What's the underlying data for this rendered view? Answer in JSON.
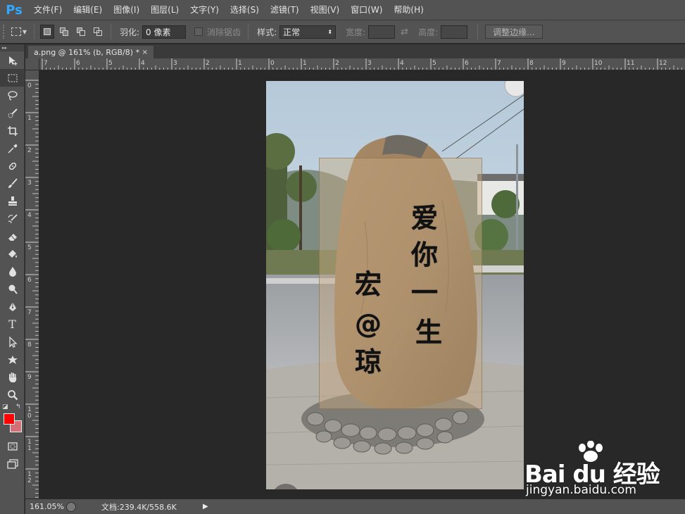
{
  "app": {
    "logo": "Ps",
    "menu": [
      "文件(F)",
      "编辑(E)",
      "图像(I)",
      "图层(L)",
      "文字(Y)",
      "选择(S)",
      "滤镜(T)",
      "视图(V)",
      "窗口(W)",
      "帮助(H)"
    ]
  },
  "options": {
    "feather_label": "羽化:",
    "feather_value": "0 像素",
    "antialias_label": "消除锯齿",
    "style_label": "样式:",
    "style_value": "正常",
    "width_label": "宽度:",
    "height_label": "高度:",
    "refine_edge_label": "调整边缘..."
  },
  "toolbar": {
    "tools": [
      "move-tool",
      "rectangular-marquee-tool",
      "lasso-tool",
      "quick-selection-tool",
      "crop-tool",
      "eyedropper-tool",
      "spot-healing-brush-tool",
      "brush-tool",
      "clone-stamp-tool",
      "history-brush-tool",
      "eraser-tool",
      "paint-bucket-tool",
      "blur-tool",
      "dodge-tool",
      "pen-tool",
      "type-tool",
      "path-selection-tool",
      "custom-shape-tool",
      "hand-tool",
      "zoom-tool"
    ],
    "foreground_color": "#ff0000",
    "background_color": "#d46f78"
  },
  "document": {
    "tab_label": "a.png @ 161% (b, RGB/8) *",
    "tab_close": "×"
  },
  "rulers": {
    "top_labels": [
      "7",
      "6",
      "5",
      "4",
      "3",
      "2",
      "1",
      "0",
      "1",
      "2",
      "3",
      "4",
      "5",
      "6",
      "7",
      "8",
      "9",
      "10",
      "11",
      "12"
    ],
    "left_labels": [
      "0",
      "1",
      "2",
      "3",
      "4",
      "5",
      "6",
      "7",
      "8",
      "9",
      "10",
      "11",
      "12"
    ]
  },
  "canvas": {
    "stone_text_right": [
      "爱",
      "你",
      "一",
      "生"
    ],
    "stone_text_left": [
      "宏",
      "@",
      "琼"
    ]
  },
  "status": {
    "zoom": "161.05%",
    "doc_info": "文档:239.4K/558.6K",
    "arrow": "▶"
  },
  "watermark": {
    "logo": "Bai du 经验",
    "url": "jingyan.baidu.com"
  }
}
